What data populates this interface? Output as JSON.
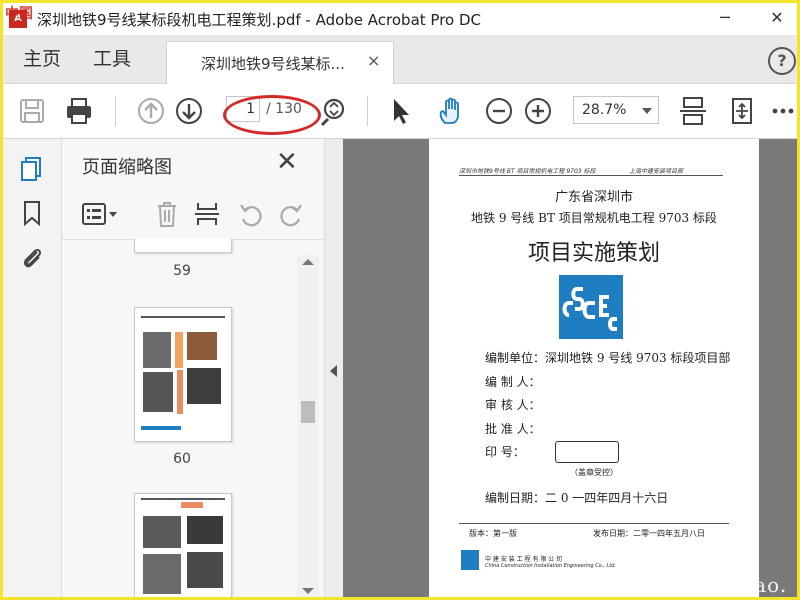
{
  "window": {
    "title": "深圳地铁9号线某标段机电工程策划.pdf - Adobe Acrobat Pro DC",
    "minimize": "─",
    "close": "✕"
  },
  "tabs": {
    "home": "主页",
    "tools": "工具",
    "document": "深圳地铁9号线某标...",
    "document_close": "×",
    "help": "?"
  },
  "toolbar": {
    "current_page": "1",
    "total_pages": "/ 130",
    "zoom": "28.7%"
  },
  "thumbnails_panel": {
    "title": "页面缩略图",
    "close": "✕",
    "page_labels": [
      "59",
      "60"
    ]
  },
  "document": {
    "header_left": "深圳市地铁9号线 BT 项目常规机电工程 9703 标段",
    "header_right": "上海中建安装项目部",
    "city": "广东省深圳市",
    "project": "地铁 9 号线 BT 项目常规机电工程 9703 标段",
    "title": "项目实施策划",
    "org_label": "编制单位：深圳地铁 9 号线 9703 标段项目部",
    "compiler_label": "编 制 人：",
    "reviewer_label": "审 核 人：",
    "approver_label": "批 准 人：",
    "seal_label": "印     号：",
    "stamp_note": "（盖章受控）",
    "date_label": "编制日期：二 0 一四年四月十六日",
    "version": "版本：第一版",
    "release": "发布日期：二零一四年五月八日",
    "company_cn": "中 建 安 装 工 程 有 限 公 司",
    "company_en": "China Construction Installation Engineering Co., Ltd."
  },
  "overlay": {
    "watermark": "www.cndao.",
    "corner": "中国"
  },
  "colors": {
    "accent_blue": "#1f7ec2",
    "highlight_frame": "#f2e32b",
    "annotation_red": "#d42a2a"
  }
}
